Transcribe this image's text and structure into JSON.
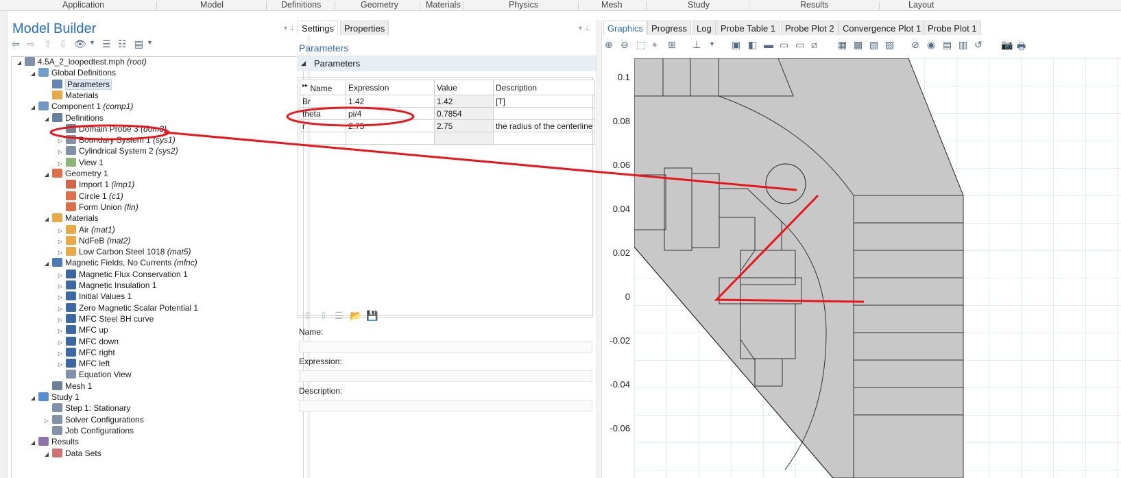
{
  "ribbon": {
    "tabs": [
      "Application",
      "Model",
      "Definitions",
      "Geometry",
      "Materials",
      "Physics",
      "Mesh",
      "Study",
      "Results",
      "Layout"
    ]
  },
  "model_builder": {
    "title": "Model Builder",
    "tree": [
      {
        "label": "4.5A_2_loopedtest.mph",
        "tag": "(root)",
        "icon": "mph-file-icon",
        "expander": "expanded"
      },
      {
        "label": "Global Definitions",
        "tag": "",
        "icon": "globe-icon",
        "expander": "expanded"
      },
      {
        "label": "Parameters",
        "tag": "",
        "icon": "parameters-icon",
        "expander": "",
        "selected": true
      },
      {
        "label": "Materials",
        "tag": "",
        "icon": "materials-icon",
        "expander": ""
      },
      {
        "label": "Component 1",
        "tag": "(comp1)",
        "icon": "component-icon",
        "expander": "expanded"
      },
      {
        "label": "Definitions",
        "tag": "",
        "icon": "definitions-icon",
        "expander": "expanded"
      },
      {
        "label": "Domain Probe 3",
        "tag": "(dom3)",
        "icon": "probe-icon",
        "expander": ""
      },
      {
        "label": "Boundary System 1",
        "tag": "(sys1)",
        "icon": "boundary-system-icon",
        "expander": "collapsed"
      },
      {
        "label": "Cylindrical System 2",
        "tag": "(sys2)",
        "icon": "cylindrical-system-icon",
        "expander": "collapsed"
      },
      {
        "label": "View 1",
        "tag": "",
        "icon": "view-icon",
        "expander": "collapsed"
      },
      {
        "label": "Geometry 1",
        "tag": "",
        "icon": "geometry-icon",
        "expander": "expanded"
      },
      {
        "label": "Import 1",
        "tag": "(imp1)",
        "icon": "import-icon",
        "expander": ""
      },
      {
        "label": "Circle 1",
        "tag": "(c1)",
        "icon": "circle-icon",
        "expander": ""
      },
      {
        "label": "Form Union",
        "tag": "(fin)",
        "icon": "form-union-icon",
        "expander": ""
      },
      {
        "label": "Materials",
        "tag": "",
        "icon": "materials-icon",
        "expander": "expanded"
      },
      {
        "label": "Air",
        "tag": "(mat1)",
        "icon": "material-icon",
        "expander": "collapsed"
      },
      {
        "label": "NdFeB",
        "tag": "(mat2)",
        "icon": "material-icon",
        "expander": "collapsed"
      },
      {
        "label": "Low Carbon Steel 1018",
        "tag": "(mat5)",
        "icon": "material-icon",
        "expander": "collapsed"
      },
      {
        "label": "Magnetic Fields, No Currents",
        "tag": "(mfnc)",
        "icon": "magnetic-fields-icon",
        "expander": "expanded"
      },
      {
        "label": "Magnetic Flux Conservation 1",
        "tag": "",
        "icon": "physics-node-icon",
        "expander": "collapsed"
      },
      {
        "label": "Magnetic Insulation 1",
        "tag": "",
        "icon": "boundary-node-icon",
        "expander": "collapsed"
      },
      {
        "label": "Initial Values 1",
        "tag": "",
        "icon": "physics-node-icon",
        "expander": "collapsed"
      },
      {
        "label": "Zero Magnetic Scalar Potential 1",
        "tag": "",
        "icon": "boundary-node-icon",
        "expander": "collapsed"
      },
      {
        "label": "MFC Steel BH curve",
        "tag": "",
        "icon": "physics-node-icon",
        "expander": "collapsed"
      },
      {
        "label": "MFC up",
        "tag": "",
        "icon": "physics-node-icon",
        "expander": "collapsed"
      },
      {
        "label": "MFC down",
        "tag": "",
        "icon": "physics-node-icon",
        "expander": "collapsed"
      },
      {
        "label": "MFC right",
        "tag": "",
        "icon": "physics-node-icon",
        "expander": "collapsed"
      },
      {
        "label": "MFC left",
        "tag": "",
        "icon": "physics-node-icon",
        "expander": "collapsed"
      },
      {
        "label": "Equation View",
        "tag": "",
        "icon": "equation-view-icon",
        "expander": ""
      },
      {
        "label": "Mesh 1",
        "tag": "",
        "icon": "mesh-icon",
        "expander": ""
      },
      {
        "label": "Study 1",
        "tag": "",
        "icon": "study-icon",
        "expander": "expanded"
      },
      {
        "label": "Step 1: Stationary",
        "tag": "",
        "icon": "stationary-step-icon",
        "expander": ""
      },
      {
        "label": "Solver Configurations",
        "tag": "",
        "icon": "solver-icon",
        "expander": "collapsed"
      },
      {
        "label": "Job Configurations",
        "tag": "",
        "icon": "job-icon",
        "expander": ""
      },
      {
        "label": "Results",
        "tag": "",
        "icon": "results-icon",
        "expander": "expanded"
      },
      {
        "label": "Data Sets",
        "tag": "",
        "icon": "datasets-icon",
        "expander": "expanded"
      }
    ]
  },
  "settings": {
    "tabs": [
      "Settings",
      "Properties"
    ],
    "section_title": "Parameters",
    "section_header": "Parameters",
    "table": {
      "columns": [
        "Name",
        "Expression",
        "Value",
        "Description"
      ],
      "rows": [
        {
          "name": "Br",
          "expression": "1.42",
          "value": "1.42",
          "description": "[T]"
        },
        {
          "name": "theta",
          "expression": "pi/4",
          "value": "0.7854",
          "description": ""
        },
        {
          "name": "r",
          "expression": "2.75",
          "value": "2.75",
          "description": "the radius of the centerline"
        }
      ]
    },
    "form": {
      "name_label": "Name:",
      "expression_label": "Expression:",
      "description_label": "Description:"
    }
  },
  "graphics": {
    "tabs": [
      "Graphics",
      "Progress",
      "Log",
      "Probe Table 1",
      "Probe Plot 2",
      "Convergence Plot 1",
      "Probe Plot 1"
    ],
    "y_ticks": [
      "0.1",
      "0.08",
      "0.06",
      "0.04",
      "0.02",
      "0",
      "-0.02",
      "-0.04",
      "-0.06"
    ]
  },
  "colors": {
    "accent": "#2a6db8",
    "annotation": "#e8151b",
    "geometry_fill": "#c8c8c8",
    "background_region": "#e4eef6"
  }
}
